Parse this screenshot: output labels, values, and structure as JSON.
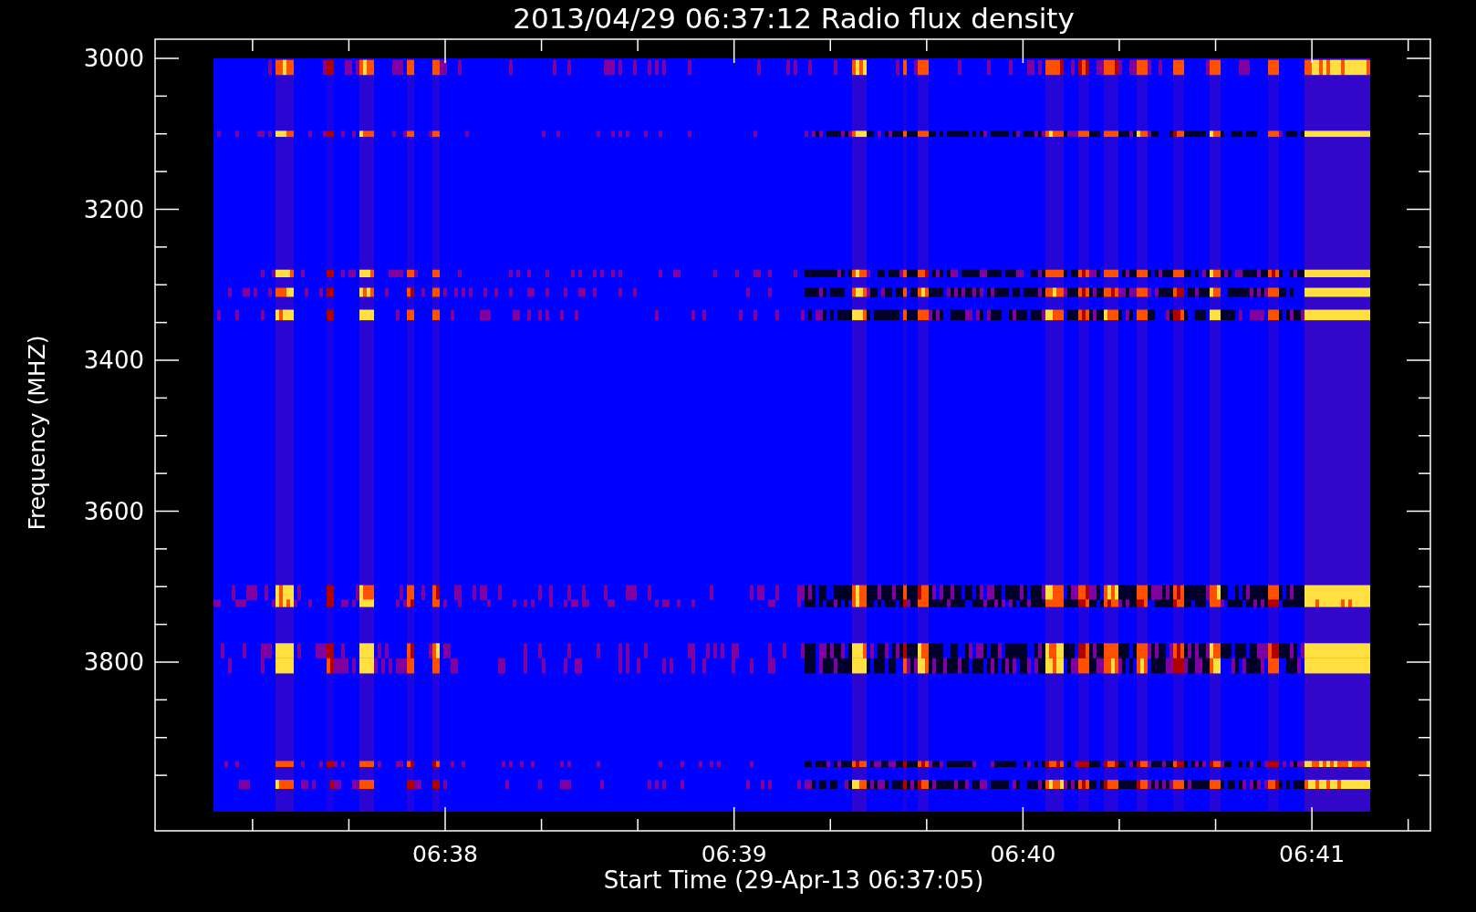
{
  "title": "2013/04/29 06:37:12 Radio flux density",
  "y_axis": {
    "label": "Frequency (MHZ)",
    "ticks": [
      "3000",
      "3200",
      "3400",
      "3600",
      "3800"
    ]
  },
  "x_axis": {
    "label": "Start Time (29-Apr-13 06:37:05)",
    "ticks": [
      "06:38",
      "06:39",
      "06:40",
      "06:41"
    ]
  }
}
